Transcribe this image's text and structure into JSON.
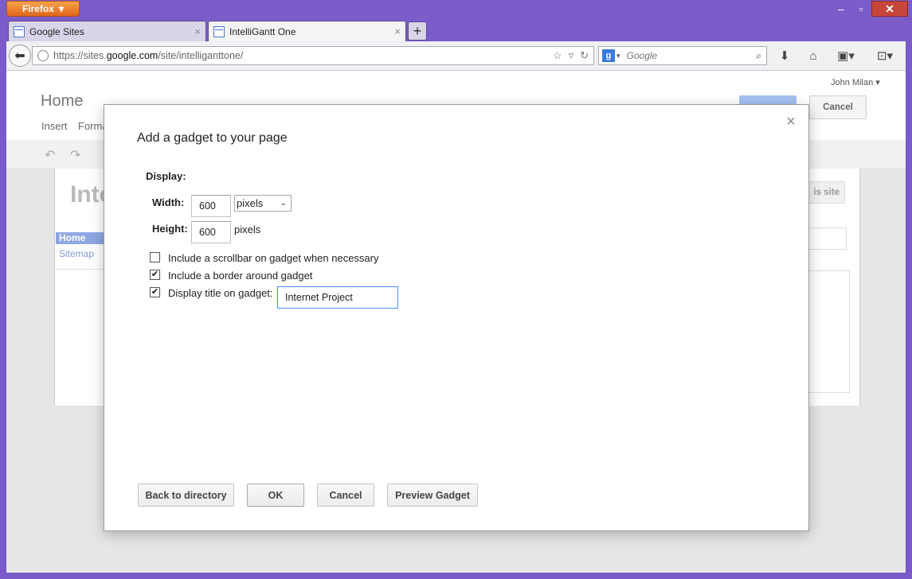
{
  "browser": {
    "menu_label": "Firefox",
    "tabs": [
      {
        "label": "Google Sites",
        "close": "×"
      },
      {
        "label": "IntelliGantt One",
        "close": "×"
      }
    ],
    "new_tab": "+",
    "url_prefix": "https://sites.",
    "url_domain": "google.com",
    "url_path": "/site/intelliganttone/",
    "search_placeholder": "Google",
    "search_engine_badge": "g"
  },
  "sites_page": {
    "user_name": "John Milan",
    "page_title": "Home",
    "menu_insert": "Insert",
    "menu_format": "Forma",
    "cancel_label": "Cancel",
    "site_title": "Inte",
    "share_label": "is site",
    "nav_home": "Home",
    "nav_sitemap": "Sitemap"
  },
  "dialog": {
    "title": "Add a gadget to your page",
    "display_label": "Display:",
    "width_label": "Width:",
    "width_value": "600",
    "width_unit": "pixels",
    "height_label": "Height:",
    "height_value": "600",
    "height_unit": "pixels",
    "options": {
      "scrollbar": {
        "label": "Include a scrollbar on gadget when necessary",
        "checked": false
      },
      "border": {
        "label": "Include a border around gadget",
        "checked": true
      },
      "title": {
        "label": "Display title on gadget:",
        "checked": true
      }
    },
    "title_value": "Internet Project",
    "buttons": {
      "back": "Back to directory",
      "ok": "OK",
      "cancel": "Cancel",
      "preview": "Preview Gadget"
    },
    "close_glyph": "×"
  }
}
